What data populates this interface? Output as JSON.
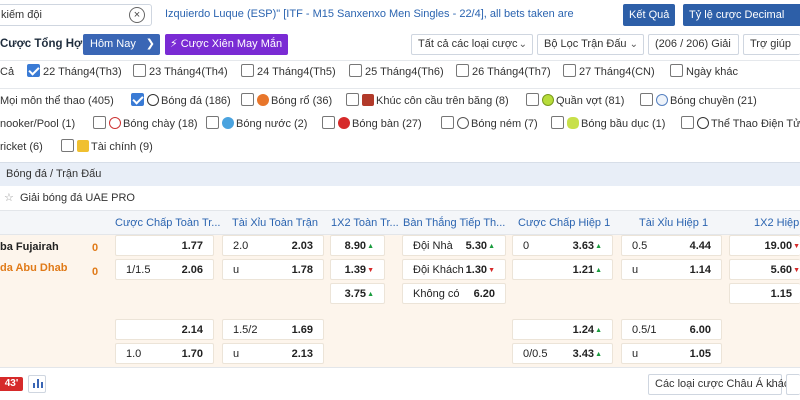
{
  "top": {
    "search_placeholder": "kiếm đội",
    "ticker": "Izquierdo Luque (ESP)\" [ITF - M15 Sanxenxo Men Singles - 22/4], all bets taken are",
    "result_button": "Kết Quả",
    "odds_type_button": "Tỷ lệ cược Decimal"
  },
  "header": {
    "title": "Cược Tổng Hợp",
    "tab_today": "Hôm Nay",
    "tab_lucky": "Cược Xiên May Mắn",
    "filter_all_bets": "Tất cả các loại cược",
    "filter_matches": "Bộ Lọc Trận Đấu",
    "count": "(206 / 206) Giải",
    "help": "Trợ giúp"
  },
  "dates": [
    {
      "label": "Cả",
      "checked": false
    },
    {
      "label": "22 Tháng4(Th3)",
      "checked": true
    },
    {
      "label": "23 Tháng4(Th4)",
      "checked": false
    },
    {
      "label": "24 Tháng4(Th5)",
      "checked": false
    },
    {
      "label": "25 Tháng4(Th6)",
      "checked": false
    },
    {
      "label": "26 Tháng4(Th7)",
      "checked": false
    },
    {
      "label": "27 Tháng4(CN)",
      "checked": false
    },
    {
      "label": "Ngày khác",
      "checked": false
    }
  ],
  "sports_row1": [
    {
      "label": "Mọi môn thể thao (405)"
    },
    {
      "label": "Bóng đá (186)",
      "checked": true
    },
    {
      "label": "Bóng rổ (36)"
    },
    {
      "label": "Khúc côn cầu trên băng (8)"
    },
    {
      "label": "Quần vợt (81)"
    },
    {
      "label": "Bóng chuyền (21)"
    }
  ],
  "sports_row2": [
    {
      "label": "nooker/Pool (1)"
    },
    {
      "label": "Bóng chày (18)"
    },
    {
      "label": "Bóng nước (2)"
    },
    {
      "label": "Bóng bàn (27)"
    },
    {
      "label": "Bóng ném (7)"
    },
    {
      "label": "Bóng bầu dục (1)"
    },
    {
      "label": "Thể Thao Điện Tử"
    }
  ],
  "sports_row3": [
    {
      "label": "ricket (6)"
    },
    {
      "label": "Tài chính (9)"
    }
  ],
  "breadcrumb": "Bóng đá / Trận Đấu",
  "league": "Giải bóng đá UAE PRO",
  "columns": [
    "Cược Chấp Toàn Tr...",
    "Tài Xỉu Toàn Trận",
    "1X2 Toàn Tr...",
    "Bàn Thắng Tiếp Th...",
    "Cược Chấp Hiệp 1",
    "Tài Xỉu Hiệp 1",
    "1X2 Hiệp"
  ],
  "match": {
    "team1": "ba Fujairah",
    "team2": "da Abu Dhab",
    "score1": "0",
    "score2": "0",
    "live_time": "43'"
  },
  "odds": {
    "r1": {
      "hdp_line": "",
      "hdp": "1.77",
      "ou_line": "2.0",
      "ou": "2.03",
      "x12": "8.90",
      "next_label": "Đội Nhà",
      "next": "5.30",
      "h1_hdp_line": "0",
      "h1_hdp": "3.63",
      "h1_ou_line": "0.5",
      "h1_ou": "4.44",
      "h1_x12": "19.00"
    },
    "r2": {
      "hdp_line": "1/1.5",
      "hdp": "2.06",
      "ou_line": "u",
      "ou": "1.78",
      "x12": "1.39",
      "next_label": "Đội Khách",
      "next": "1.30",
      "h1_hdp_line": "",
      "h1_hdp": "1.21",
      "h1_ou_line": "u",
      "h1_ou": "1.14",
      "h1_x12": "5.60"
    },
    "r3": {
      "x12": "3.75",
      "next_label": "Không có",
      "next": "6.20",
      "h1_x12": "1.15"
    },
    "r4": {
      "hdp": "2.14",
      "ou_line": "1.5/2",
      "ou": "1.69",
      "h1_hdp": "1.24",
      "h1_ou_line": "0.5/1",
      "h1_ou": "6.00"
    },
    "r5": {
      "hdp_line": "1.0",
      "hdp": "1.70",
      "ou_line": "u",
      "ou": "2.13",
      "h1_hdp_line": "0/0.5",
      "h1_hdp": "3.43",
      "h1_ou_line": "u",
      "h1_ou": "1.05"
    }
  },
  "footer": {
    "bet_type_select": "Các loại cược Châu Á khác"
  }
}
